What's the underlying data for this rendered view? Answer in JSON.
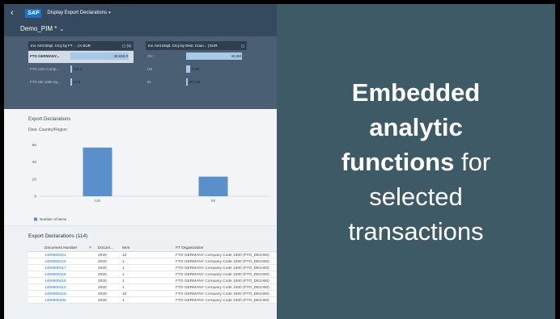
{
  "header": {
    "back_glyph": "‹",
    "logo": "SAP",
    "title": "Display Export Declarations",
    "title_caret": "▾"
  },
  "variant": {
    "name": "Demo_PIM *",
    "chevron": "⌄"
  },
  "kpi_cards": [
    {
      "title": "Inv. Amt Displ. Crcy by FT ... | K EUR",
      "count": "(1)",
      "rows": [
        {
          "label": "FTO GERMANY...",
          "value": "48.659,9",
          "fill": 1.0,
          "selected": true
        },
        {
          "label": "FTO USA Comp...",
          "value": "115,1",
          "fill": 0.003,
          "selected": false
        },
        {
          "label": "FTO DE 1000 Sy...",
          "value": "92,5",
          "fill": 0.002,
          "selected": false
        }
      ]
    },
    {
      "title": "Inv. Amt Displ. Crcy by Dest. Coun... | EUR",
      "count": "",
      "rows": [
        {
          "label": "CH",
          "value": "44,2M",
          "fill": 1.0,
          "selected": false
        },
        {
          "label": "US",
          "value": "2,9M",
          "fill": 0.066,
          "selected": false
        },
        {
          "label": "IN",
          "value": "907,6K",
          "fill": 0.021,
          "selected": false
        }
      ]
    }
  ],
  "chart_section": {
    "title": "Export Declarations",
    "subtitle": "Dest. Country/Region"
  },
  "chart_data": {
    "type": "bar",
    "categories": [
      "US",
      "IN"
    ],
    "series": [
      {
        "name": "Number of Items",
        "values": [
          57,
          23
        ],
        "color": "#5b8fc9"
      }
    ],
    "yticks": [
      0,
      20,
      40,
      60
    ],
    "ylim": [
      0,
      70
    ],
    "legend_placement": "bottom-left",
    "grid": false
  },
  "table": {
    "title": "Export Declarations (114)",
    "columns": [
      "Document Number",
      "Docum...",
      "Item",
      "FT Organization"
    ],
    "rows": [
      [
        "1400000421",
        "2020",
        "10",
        "FTO GERMANY Company Code 1000 (FTO_DE1000)"
      ],
      [
        "1400000418",
        "2020",
        "1",
        "FTO GERMANY Company Code 1000 (FTO_DE1000)"
      ],
      [
        "1400000417",
        "2020",
        "1",
        "FTO GERMANY Company Code 1000 (FTO_DE1000)"
      ],
      [
        "1400000416",
        "2020",
        "1",
        "FTO GERMANY Company Code 1000 (FTO_DE1000)"
      ],
      [
        "1400000415",
        "2020",
        "1",
        "FTO GERMANY Company Code 1000 (FTO_DE1000)"
      ],
      [
        "1400000413",
        "2020",
        "1",
        "FTO GERMANY Company Code 1000 (FTO_DE1000)"
      ],
      [
        "1400000410",
        "2020",
        "10",
        "FTO GERMANY Company Code 1000 (FTO_DE1000)"
      ],
      [
        "1400000404",
        "2020",
        "1",
        "FTO GERMANY Company Code 1000 (FTO_DE1000)"
      ]
    ]
  },
  "panel": {
    "line1": "Embedded",
    "line2": "analytic",
    "line3_bold": "functions",
    "line3_rest": " for",
    "line4": "selected",
    "line5": "transactions"
  },
  "colors": {
    "shell": "#354a5f",
    "panel": "#3e5a66",
    "bar": "#5b8fc9",
    "link": "#2a6ab0"
  }
}
